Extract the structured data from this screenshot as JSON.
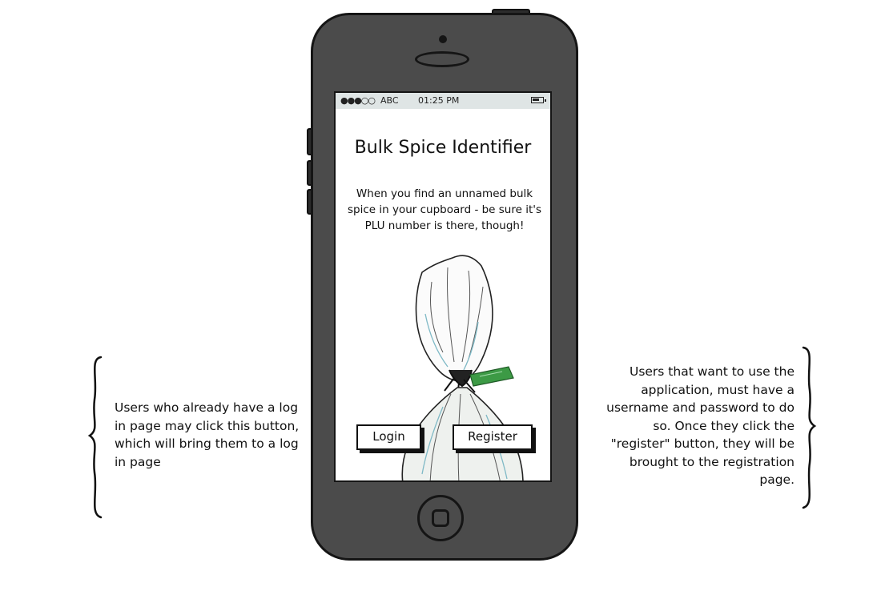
{
  "status_bar": {
    "signal": "●●●○○",
    "carrier": "ABC",
    "time": "01:25 PM",
    "battery_icon": "battery-icon"
  },
  "app": {
    "title": "Bulk Spice Identifier",
    "description": "When you find an unnamed bulk spice in your cupboard - be sure it's PLU number is there, though!",
    "illustration": "spice-bag-illustration",
    "login_label": "Login",
    "register_label": "Register"
  },
  "annotations": {
    "left": "Users who already have a log in page may click this button, which will bring them to a log in page",
    "right": "Users that want to use the application, must have a username and password to do so.  Once they click the \"register\" button, they will be brought to the registration page."
  },
  "colors": {
    "phone_body": "#4b4b4b",
    "phone_outline": "#151515",
    "status_bar": "#dfe5e5",
    "screen": "#ffffff",
    "tag_green": "#3c9a45"
  }
}
